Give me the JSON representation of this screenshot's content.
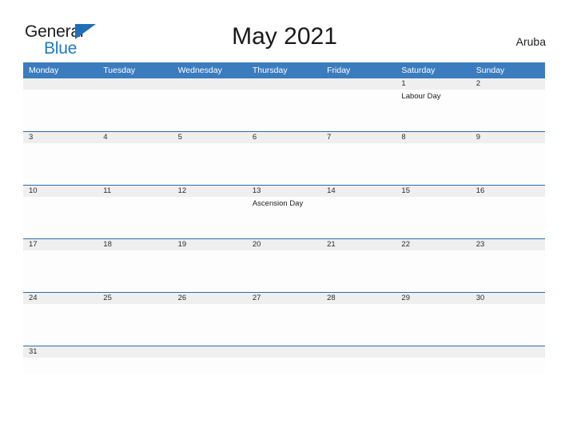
{
  "brand": {
    "name_part1": "General",
    "name_part2": "Blue",
    "flag_icon": "flag-triangle-icon",
    "accent_color": "#1f7ac4"
  },
  "header": {
    "title": "May 2021",
    "country": "Aruba"
  },
  "colors": {
    "header_blue": "#3b7cbf",
    "row_divider_blue": "#2d6ca8",
    "date_strip_gray": "#efefef",
    "page_background": "#ffffff"
  },
  "calendar": {
    "weekdays": [
      "Monday",
      "Tuesday",
      "Wednesday",
      "Thursday",
      "Friday",
      "Saturday",
      "Sunday"
    ],
    "weeks": [
      {
        "dates": [
          "",
          "",
          "",
          "",
          "",
          "1",
          "2"
        ],
        "events": [
          "",
          "",
          "",
          "",
          "",
          "Labour Day",
          ""
        ]
      },
      {
        "dates": [
          "3",
          "4",
          "5",
          "6",
          "7",
          "8",
          "9"
        ],
        "events": [
          "",
          "",
          "",
          "",
          "",
          "",
          ""
        ]
      },
      {
        "dates": [
          "10",
          "11",
          "12",
          "13",
          "14",
          "15",
          "16"
        ],
        "events": [
          "",
          "",
          "",
          "Ascension Day",
          "",
          "",
          ""
        ]
      },
      {
        "dates": [
          "17",
          "18",
          "19",
          "20",
          "21",
          "22",
          "23"
        ],
        "events": [
          "",
          "",
          "",
          "",
          "",
          "",
          ""
        ]
      },
      {
        "dates": [
          "24",
          "25",
          "26",
          "27",
          "28",
          "29",
          "30"
        ],
        "events": [
          "",
          "",
          "",
          "",
          "",
          "",
          ""
        ]
      },
      {
        "dates": [
          "31",
          "",
          "",
          "",
          "",
          "",
          ""
        ],
        "events": [
          "",
          "",
          "",
          "",
          "",
          "",
          ""
        ]
      }
    ]
  }
}
